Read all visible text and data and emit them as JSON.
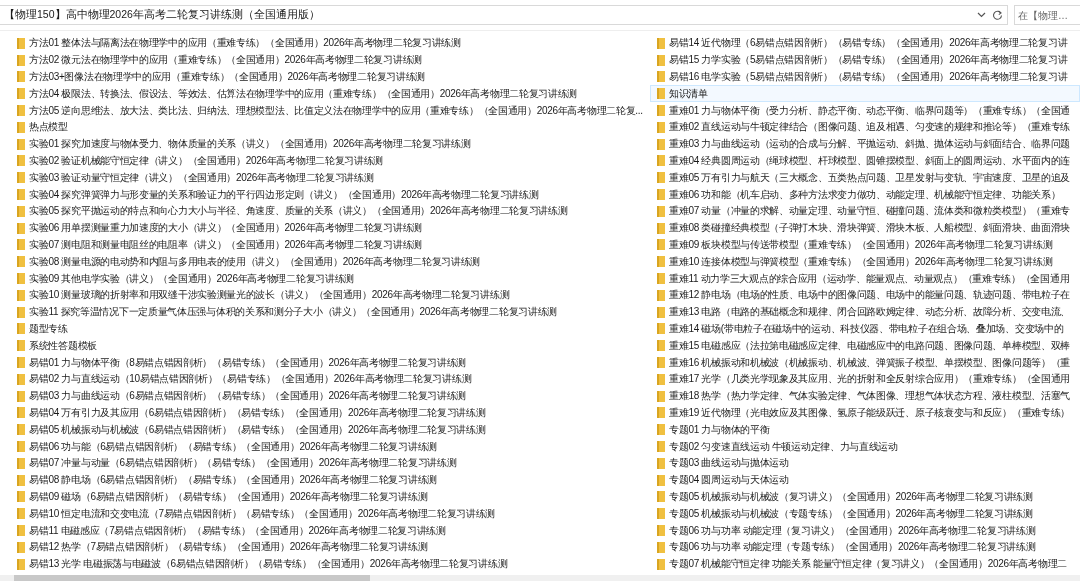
{
  "address_bar": {
    "path": "【物理150】高中物理2026年高考二轮复习讲练测（全国通用版）"
  },
  "search": {
    "placeholder": "在【物理…"
  },
  "file_list": {
    "columns": [
      {
        "items": [
          {
            "name": "方法01 整体法与隔离法在物理学中的应用（重难专练）（全国通用）2026年高考物理二轮复习讲练测",
            "selected": false
          },
          {
            "name": "方法02 微元法在物理学中的应用（重难专练）（全国通用）2026年高考物理二轮复习讲练测",
            "selected": false
          },
          {
            "name": "方法03+图像法在物理学中的应用（重难专练）（全国通用）2026年高考物理二轮复习讲练测",
            "selected": false
          },
          {
            "name": "方法04 极限法、转换法、假设法、等效法、估算法在物理学中的应用（重难专练）（全国通用）2026年高考物理二轮复习讲练测",
            "selected": false
          },
          {
            "name": "方法05 逆向思维法、放大法、类比法、归纳法、理想模型法、比值定义法在物理学中的应用（重难专练）（全国通用）2026年高考物理二轮复...",
            "selected": false
          },
          {
            "name": "热点模型",
            "selected": false
          },
          {
            "name": "实验01 探究加速度与物体受力、物体质量的关系（讲义）（全国通用）2026年高考物理二轮复习讲练测",
            "selected": false
          },
          {
            "name": "实验02 验证机械能守恒定律（讲义）（全国通用）2026年高考物理二轮复习讲练测",
            "selected": false
          },
          {
            "name": "实验03 验证动量守恒定律（讲义）（全国通用）2026年高考物理二轮复习讲练测",
            "selected": false
          },
          {
            "name": "实验04 探究弹簧弹力与形变量的关系和验证力的平行四边形定则（讲义）（全国通用）2026年高考物理二轮复习讲练测",
            "selected": false
          },
          {
            "name": "实验05 探究平抛运动的特点和向心力大小与半径、角速度、质量的关系（讲义）（全国通用）2026年高考物理二轮复习讲练测",
            "selected": false
          },
          {
            "name": "实验06 用单摆测量重力加速度的大小（讲义）（全国通用）2026年高考物理二轮复习讲练测",
            "selected": false
          },
          {
            "name": "实验07 测电阻和测量电阻丝的电阻率（讲义）（全国通用）2026年高考物理二轮复习讲练测",
            "selected": false
          },
          {
            "name": "实验08 测量电源的电动势和内阻与多用电表的使用（讲义）（全国通用）2026年高考物理二轮复习讲练测",
            "selected": false
          },
          {
            "name": "实验09 其他电学实验（讲义）（全国通用）2026年高考物理二轮复习讲练测",
            "selected": false
          },
          {
            "name": "实验10 测量玻璃的折射率和用双缝干涉实验测量光的波长（讲义）（全国通用）2026年高考物理二轮复习讲练测",
            "selected": false
          },
          {
            "name": "实验11 探究等温情况下一定质量气体压强与体积的关系和测分子大小（讲义）（全国通用）2026年高考物理二轮复习讲练测",
            "selected": false
          },
          {
            "name": "题型专练",
            "selected": false
          },
          {
            "name": "系统性答题模板",
            "selected": false
          },
          {
            "name": "易错01 力与物体平衡（8易错点错因剖析）（易错专练）（全国通用）2026年高考物理二轮复习讲练测",
            "selected": false
          },
          {
            "name": "易错02 力与直线运动（10易错点错因剖析）（易错专练）（全国通用）2026年高考物理二轮复习讲练测",
            "selected": false
          },
          {
            "name": "易错03 力与曲线运动（6易错点错因剖析）（易错专练）（全国通用）2026年高考物理二轮复习讲练测",
            "selected": false
          },
          {
            "name": "易错04 万有引力及其应用（6易错点错因剖析）（易错专练）（全国通用）2026年高考物理二轮复习讲练测",
            "selected": false
          },
          {
            "name": "易错05 机械振动与机械波（6易错点错因剖析）（易错专练）（全国通用）2026年高考物理二轮复习讲练测",
            "selected": false
          },
          {
            "name": "易错06 功与能（6易错点错因剖析）（易错专练）（全国通用）2026年高考物理二轮复习讲练测",
            "selected": false
          },
          {
            "name": "易错07 冲量与动量（6易错点错因剖析）（易错专练）（全国通用）2026年高考物理二轮复习讲练测",
            "selected": false
          },
          {
            "name": "易错08 静电场（6易错点错因剖析）（易错专练）（全国通用）2026年高考物理二轮复习讲练测",
            "selected": false
          },
          {
            "name": "易错09 磁场（6易错点错因剖析）（易错专练）（全国通用）2026年高考物理二轮复习讲练测",
            "selected": false
          },
          {
            "name": "易错10 恒定电流和交变电流（7易错点错因剖析）（易错专练）（全国通用）2026年高考物理二轮复习讲练测",
            "selected": false
          },
          {
            "name": "易错11 电磁感应（7易错点错因剖析）（易错专练）（全国通用）2026年高考物理二轮复习讲练测",
            "selected": false
          },
          {
            "name": "易错12 热学（7易错点错因剖析）（易错专练）（全国通用）2026年高考物理二轮复习讲练测",
            "selected": false
          },
          {
            "name": "易错13 光学 电磁振荡与电磁波（6易错点错因剖析）（易错专练）（全国通用）2026年高考物理二轮复习讲练测",
            "selected": false
          }
        ]
      },
      {
        "items": [
          {
            "name": "易错14 近代物理（6易错点错因剖析）（易错专练）（全国通用）2026年高考物理二轮复习讲",
            "selected": false
          },
          {
            "name": "易错15 力学实验（5易错点错因剖析）（易错专练）（全国通用）2026年高考物理二轮复习讲",
            "selected": false
          },
          {
            "name": "易错16 电学实验（5易错点错因剖析）（易错专练）（全国通用）2026年高考物理二轮复习讲",
            "selected": false
          },
          {
            "name": "知识清单",
            "selected": true
          },
          {
            "name": "重难01 力与物体平衡（受力分析、静态平衡、动态平衡、临界问题等）（重难专练）（全国通",
            "selected": false
          },
          {
            "name": "重难02 直线运动与牛顿定律结合（图像问题、追及相遇、匀变速的规律和推论等）（重难专练",
            "selected": false
          },
          {
            "name": "重难03 力与曲线运动（运动的合成与分解、平抛运动、斜抛、抛体运动与斜面结合、临界问题",
            "selected": false
          },
          {
            "name": "重难04 经典圆周运动（绳球模型、杆球模型、圆锥摆模型、斜面上的圆周运动、水平面内的连",
            "selected": false
          },
          {
            "name": "重难05 万有引力与航天（三大概念、五类热点问题、卫星发射与变轨、宇宙速度、卫星的追及",
            "selected": false
          },
          {
            "name": "重难06 功和能（机车启动、多种方法求变力做功、动能定理、机械能守恒定律、功能关系）",
            "selected": false
          },
          {
            "name": "重难07 动量（冲量的求解、动量定理、动量守恒、碰撞问题、流体类和微粒类模型）（重难专",
            "selected": false
          },
          {
            "name": "重难08 类碰撞经典模型（子弹打木块、滑块弹簧、滑块木板、人船模型、斜面滑块、曲面滑块",
            "selected": false
          },
          {
            "name": "重难09 板块模型与传送带模型（重难专练）（全国通用）2026年高考物理二轮复习讲练测",
            "selected": false
          },
          {
            "name": "重难10 连接体模型与弹簧模型（重难专练）（全国通用）2026年高考物理二轮复习讲练测",
            "selected": false
          },
          {
            "name": "重难11 动力学三大观点的综合应用（运动学、能量观点、动量观点）（重难专练）（全国通用",
            "selected": false
          },
          {
            "name": "重难12 静电场（电场的性质、电场中的图像问题、电场中的能量问题、轨迹问题、带电粒子在",
            "selected": false
          },
          {
            "name": "重难13 电路（电路的基础概念和规律、闭合回路欧姆定律、动态分析、故障分析、交变电流、",
            "selected": false
          },
          {
            "name": "重难14 磁场(带电粒子在磁场中的运动、科技仪器、带电粒子在组合场、叠加场、交变场中的",
            "selected": false
          },
          {
            "name": "重难15 电磁感应（法拉第电磁感应定律、电磁感应中的电路问题、图像问题、单棒模型、双棒",
            "selected": false
          },
          {
            "name": "重难16 机械振动和机械波（机械振动、机械波、弹簧振子模型、单摆模型、图像问题等）（重",
            "selected": false
          },
          {
            "name": "重难17 光学（几类光学现象及其应用、光的折射和全反射综合应用）（重难专练）（全国通用",
            "selected": false
          },
          {
            "name": "重难18 热学（热力学定律、气体实验定律、气体图像、理想气体状态方程、液柱模型、活塞气",
            "selected": false
          },
          {
            "name": "重难19 近代物理（光电效应及其图像、氢原子能级跃迁、原子核衰变与和反应）（重难专练）",
            "selected": false
          },
          {
            "name": "专题01 力与物体的平衡",
            "selected": false
          },
          {
            "name": "专题02 匀变速直线运动 牛顿运动定律、力与直线运动",
            "selected": false
          },
          {
            "name": "专题03 曲线运动与抛体运动",
            "selected": false
          },
          {
            "name": "专题04 圆周运动与天体运动",
            "selected": false
          },
          {
            "name": "专题05 机械振动与机械波（复习讲义）（全国通用）2026年高考物理二轮复习讲练测",
            "selected": false
          },
          {
            "name": "专题05 机械振动与机械波（专题专练）（全国通用）2026年高考物理二轮复习讲练测",
            "selected": false
          },
          {
            "name": "专题06 功与功率 动能定理（复习讲义）（全国通用）2026年高考物理二轮复习讲练测",
            "selected": false
          },
          {
            "name": "专题06 功与功率 动能定理（专题专练）（全国通用）2026年高考物理二轮复习讲练测",
            "selected": false
          },
          {
            "name": "专题07 机械能守恒定律 功能关系 能量守恒定律（复习讲义）（全国通用）2026年高考物理二",
            "selected": false
          }
        ]
      }
    ]
  }
}
